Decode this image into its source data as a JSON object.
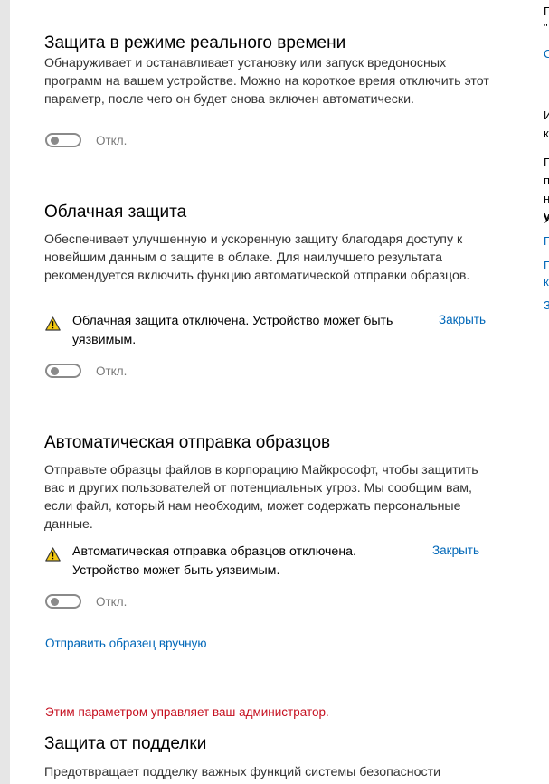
{
  "realtime": {
    "title": "Защита в режиме реального времени",
    "description": "Обнаруживает и останавливает установку или запуск вредоносных программ на вашем устройстве. Можно на короткое время отключить этот параметр, после чего он будет снова включен автоматически.",
    "toggle_label": "Откл.",
    "toggle_on": false
  },
  "cloud": {
    "title": "Облачная защита",
    "description": "Обеспечивает улучшенную и ускоренную защиту благодаря доступу к новейшим данным о защите в облаке. Для наилучшего результата рекомендуется включить функцию автоматической отправки образцов.",
    "warning_text": "Облачная защита отключена. Устройство может быть уязвимым.",
    "close_label": "Закрыть",
    "toggle_label": "Откл.",
    "toggle_on": false
  },
  "samples": {
    "title": "Автоматическая отправка образцов",
    "description": "Отправьте образцы файлов в корпорацию Майкрософт, чтобы защитить вас и других пользователей от потенциальных угроз. Мы сообщим вам, если файл, который нам необходим, может содержать персональные данные.",
    "warning_text": "Автоматическая отправка образцов отключена. Устройство может быть уязвимым.",
    "close_label": "Закрыть",
    "toggle_label": "Откл.",
    "toggle_on": false,
    "manual_link": "Отправить образец вручную"
  },
  "admin_note": "Этим параметром управляет ваш администратор.",
  "tamper": {
    "title": "Защита от подделки",
    "description": "Предотвращает подделку важных функций системы безопасности"
  },
  "side_panel": {
    "fragments": [
      "П",
      "\"",
      "C",
      "И",
      "к",
      "П",
      "п",
      "н",
      "у",
      "V",
      "П",
      "П",
      "к",
      "З"
    ]
  },
  "colors": {
    "link": "#0067b8",
    "admin_warning": "#c50f1f",
    "warning_icon": "#f2c811"
  }
}
